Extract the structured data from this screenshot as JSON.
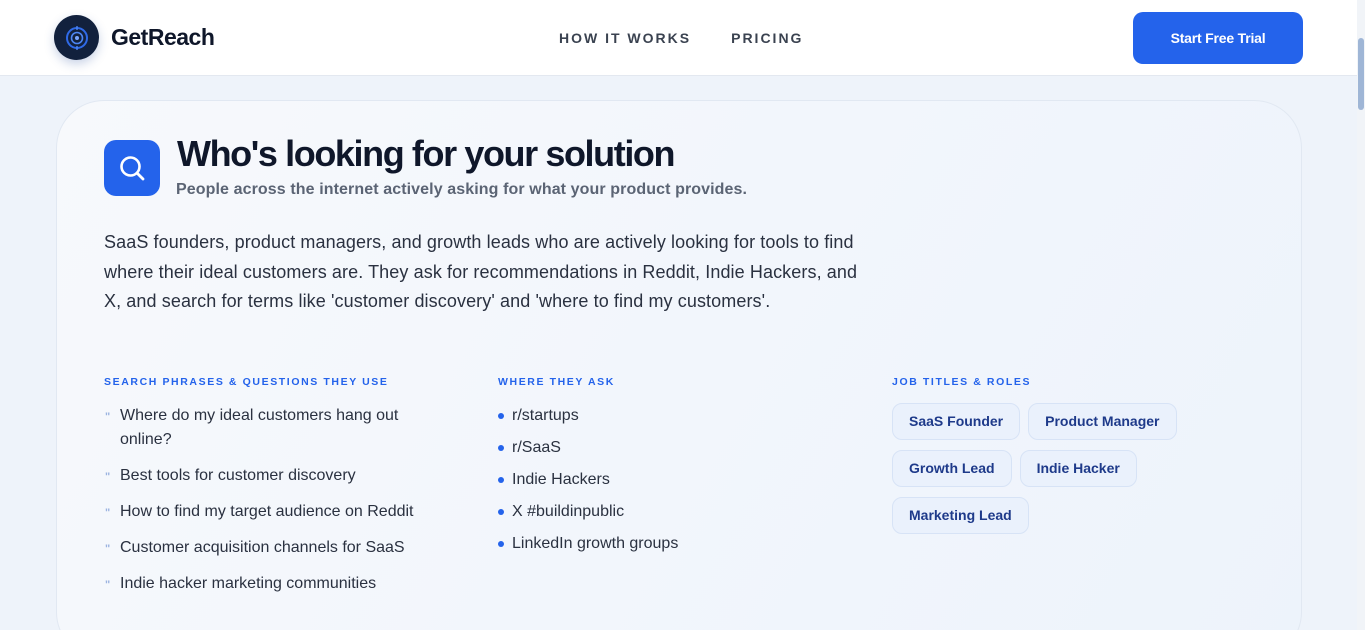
{
  "header": {
    "brand": "GetReach",
    "nav": [
      "HOW IT WORKS",
      "PRICING"
    ],
    "cta_label": "Start Free Trial"
  },
  "section": {
    "title": "Who's looking for your solution",
    "subtitle": "People across the internet actively asking for what your product provides.",
    "description": "SaaS founders, product managers, and growth leads who are actively looking for tools to find where their ideal customers are. They ask for recommendations in Reddit, Indie Hackers, and X, and search for terms like 'customer discovery' and 'where to find my customers'.",
    "phrases": {
      "heading": "SEARCH PHRASES & QUESTIONS THEY USE",
      "items": [
        "Where do my ideal customers hang out online?",
        "Best tools for customer discovery",
        "How to find my target audience on Reddit",
        "Customer acquisition channels for SaaS",
        "Indie hacker marketing communities"
      ]
    },
    "where": {
      "heading": "WHERE THEY ASK",
      "items": [
        "r/startups",
        "r/SaaS",
        "Indie Hackers",
        "X #buildinpublic",
        "LinkedIn growth groups"
      ]
    },
    "roles": {
      "heading": "JOB TITLES & ROLES",
      "items": [
        "SaaS Founder",
        "Product Manager",
        "Growth Lead",
        "Indie Hacker",
        "Marketing Lead"
      ]
    }
  },
  "colors": {
    "accent": "#2463eb",
    "logo_bg": "#12213d",
    "text_dark": "#0f172a",
    "tag_text": "#1e3a8a",
    "tag_bg": "#eaf1fc"
  },
  "icons": {
    "logo": "target-icon",
    "section": "search-icon",
    "phrase_bullet": "quote-icon",
    "where_bullet": "dot-icon"
  }
}
